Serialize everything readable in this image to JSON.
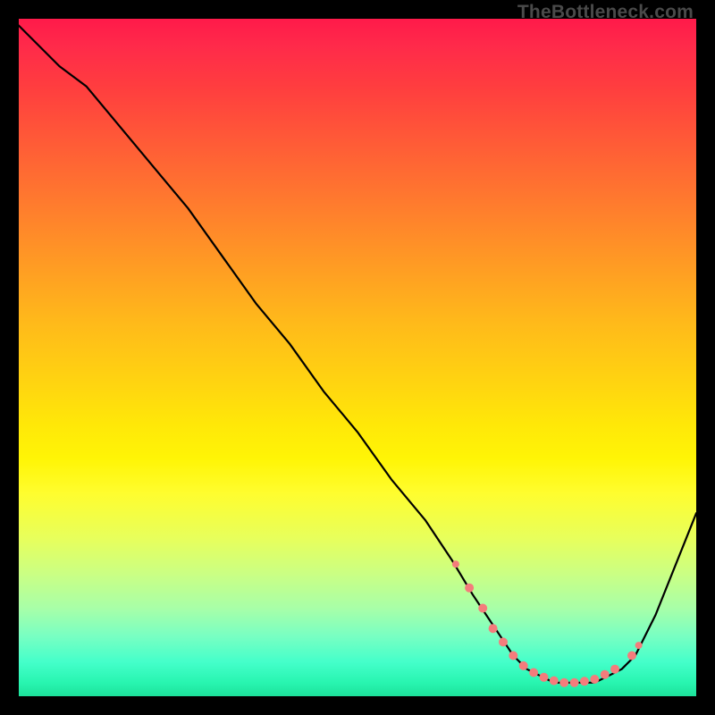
{
  "attribution": "TheBottleneck.com",
  "chart_data": {
    "type": "line",
    "title": "",
    "xlabel": "",
    "ylabel": "",
    "xlim": [
      0,
      100
    ],
    "ylim": [
      0,
      100
    ],
    "series": [
      {
        "name": "bottleneck-curve",
        "x": [
          0,
          6,
          10,
          15,
          20,
          25,
          30,
          35,
          40,
          45,
          50,
          55,
          60,
          64,
          67,
          69,
          71,
          73,
          75,
          77,
          79,
          81,
          83,
          85,
          87,
          89,
          91,
          94,
          100
        ],
        "y": [
          99,
          93,
          90,
          84,
          78,
          72,
          65,
          58,
          52,
          45,
          39,
          32,
          26,
          20,
          15,
          12,
          9,
          6,
          4,
          3,
          2,
          2,
          2,
          2,
          3,
          4,
          6,
          12,
          27
        ]
      }
    ],
    "markers": {
      "name": "optimal-range-dots",
      "points": [
        {
          "x": 64.5,
          "y": 19.5,
          "r": 4
        },
        {
          "x": 66.5,
          "y": 16.0,
          "r": 5
        },
        {
          "x": 68.5,
          "y": 13.0,
          "r": 5
        },
        {
          "x": 70.0,
          "y": 10.0,
          "r": 5
        },
        {
          "x": 71.5,
          "y": 8.0,
          "r": 5
        },
        {
          "x": 73.0,
          "y": 6.0,
          "r": 5
        },
        {
          "x": 74.5,
          "y": 4.5,
          "r": 5
        },
        {
          "x": 76.0,
          "y": 3.5,
          "r": 5
        },
        {
          "x": 77.5,
          "y": 2.8,
          "r": 5
        },
        {
          "x": 79.0,
          "y": 2.3,
          "r": 5
        },
        {
          "x": 80.5,
          "y": 2.0,
          "r": 5
        },
        {
          "x": 82.0,
          "y": 2.0,
          "r": 5
        },
        {
          "x": 83.5,
          "y": 2.2,
          "r": 5
        },
        {
          "x": 85.0,
          "y": 2.5,
          "r": 5
        },
        {
          "x": 86.5,
          "y": 3.2,
          "r": 5
        },
        {
          "x": 88.0,
          "y": 4.0,
          "r": 5
        },
        {
          "x": 90.5,
          "y": 6.0,
          "r": 5
        },
        {
          "x": 91.5,
          "y": 7.5,
          "r": 4
        }
      ]
    }
  }
}
